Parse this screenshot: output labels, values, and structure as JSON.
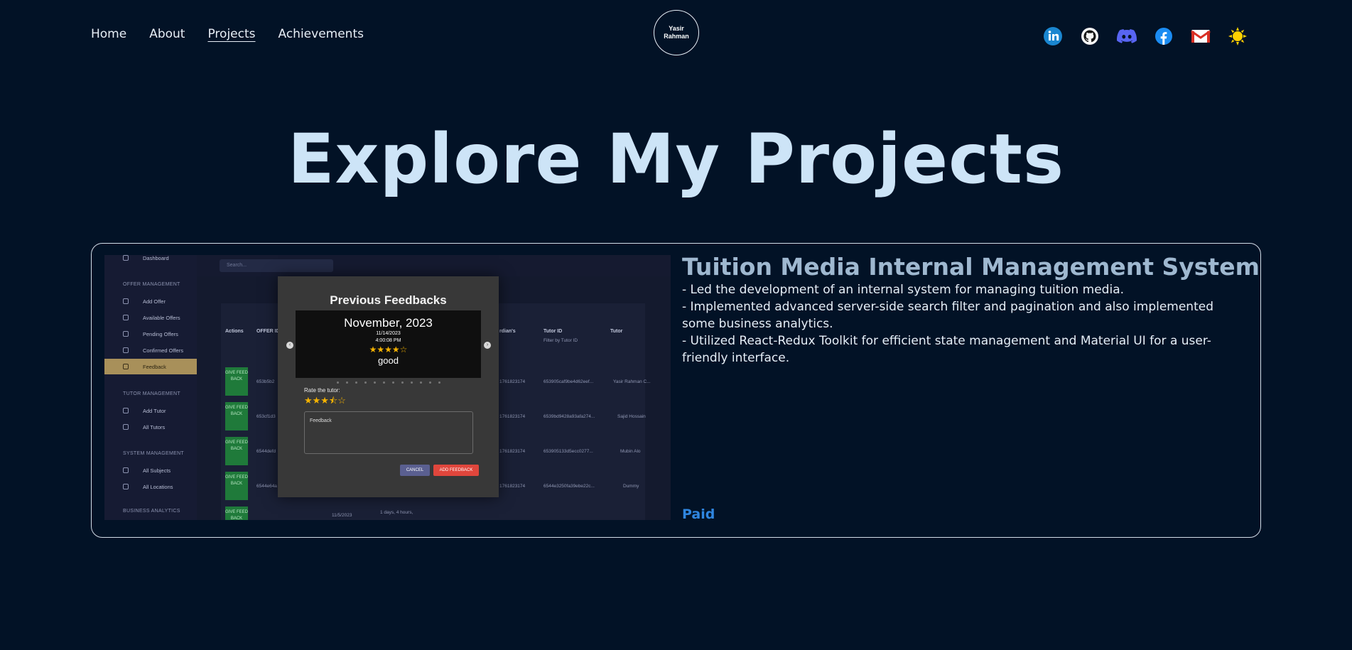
{
  "nav": {
    "links": [
      "Home",
      "About",
      "Projects",
      "Achievements"
    ],
    "active": "Projects",
    "logo_line1": "Yasir",
    "logo_line2": "Rahman",
    "socials": [
      "linkedin-icon",
      "github-icon",
      "discord-icon",
      "facebook-icon",
      "gmail-icon",
      "sun-icon"
    ]
  },
  "hero": {
    "title": "Explore My Projects"
  },
  "project": {
    "title": "Tuition Media Internal Management System",
    "bullets": [
      "- Led the development of an internal system for managing tuition media.",
      "- Implemented advanced server-side search filter and pagination and also implemented some business analytics.",
      "- Utilized React-Redux Toolkit for efficient state management and Material UI for a user-friendly interface."
    ],
    "status": "Paid"
  },
  "screenshot": {
    "sidebar": {
      "top_item": "Dashboard",
      "group1": "OFFER MANAGEMENT",
      "g1_items": [
        "Add Offer",
        "Available Offers",
        "Pending Offers",
        "Confirmed Offers",
        "Feedback"
      ],
      "group2": "TUTOR MANAGEMENT",
      "g2_items": [
        "Add Tutor",
        "All Tutors"
      ],
      "group3": "SYSTEM MANAGEMENT",
      "g3_items": [
        "All Subjects",
        "All Locations"
      ],
      "group4": "BUSINESS ANALYTICS"
    },
    "search_placeholder": "Search...",
    "table_headers": [
      "Actions",
      "OFFER ID",
      "rdian's",
      "Tutor ID",
      "Tutor"
    ],
    "filter_tutor_id": "Filter by Tutor ID",
    "give_feedback": "GIVE FEED BACK",
    "rows": [
      {
        "offer": "653b5b2",
        "phone": "1761823174",
        "tutor_id": "653905caf9be4d62eef...",
        "tutor": "Yasir Rahman C..."
      },
      {
        "offer": "653cf1d3",
        "phone": "1761823174",
        "tutor_id": "6539bd9428a93afa274...",
        "tutor": "Sajid Hossain"
      },
      {
        "offer": "6544defd",
        "phone": "1761823174",
        "tutor_id": "653905133d5ecc0277...",
        "tutor": "Mubin Alo"
      },
      {
        "offer": "6544e64a",
        "phone": "1761823174",
        "tutor_id": "6544e3250fa39ebe22c...",
        "tutor": "Dummy"
      }
    ],
    "bottom_date": "11/5/2023",
    "bottom_time": "1 days, 4 hours,",
    "modal": {
      "title": "Previous Feedbacks",
      "month": "November, 2023",
      "date": "11/14/2023",
      "time": "4:00:08 PM",
      "stars": "★★★★☆",
      "comment": "good",
      "rate_label": "Rate the tutor:",
      "rate_stars": "★★★⯪☆",
      "feedback_label": "Feedback",
      "cancel": "CANCEL",
      "add": "ADD FEEDBACK"
    }
  },
  "colors": {
    "background": "#021226",
    "hero": "#cde4f7",
    "project_title": "#9fb8d0",
    "paid": "#2f86e0"
  }
}
